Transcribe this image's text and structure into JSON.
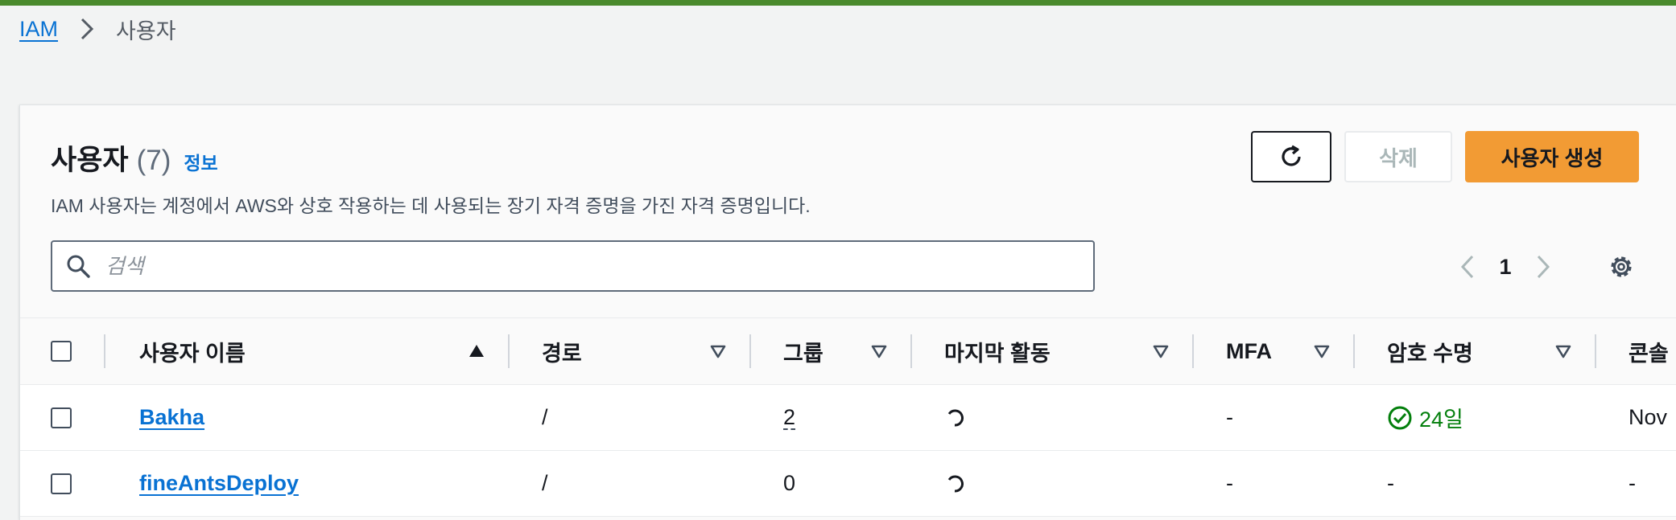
{
  "breadcrumb": {
    "root": "IAM",
    "current": "사용자"
  },
  "header": {
    "title": "사용자",
    "count": "(7)",
    "info": "정보",
    "description": "IAM 사용자는 계정에서 AWS와 상호 작용하는 데 사용되는 장기 자격 증명을 가진 자격 증명입니다."
  },
  "actions": {
    "refresh_icon": "refresh-icon",
    "delete": "삭제",
    "create": "사용자 생성"
  },
  "search": {
    "placeholder": "검색",
    "value": ""
  },
  "pagination": {
    "page": "1"
  },
  "columns": {
    "username": "사용자 이름",
    "path": "경로",
    "groups": "그룹",
    "last_activity": "마지막 활동",
    "mfa": "MFA",
    "password_age": "암호 수명",
    "console": "콘솔"
  },
  "rows": [
    {
      "username": "Bakha",
      "path": "/",
      "groups": "2",
      "mfa": "-",
      "password_age": "24일",
      "console": "Nov"
    },
    {
      "username": "fineAntsDeploy",
      "path": "/",
      "groups": "0",
      "mfa": "-",
      "password_age": "-",
      "console": "-"
    }
  ],
  "colors": {
    "accent": "#0972d3",
    "primary_button": "#f29b34",
    "top_bar": "#4a8a2c",
    "success": "#037f0c"
  }
}
